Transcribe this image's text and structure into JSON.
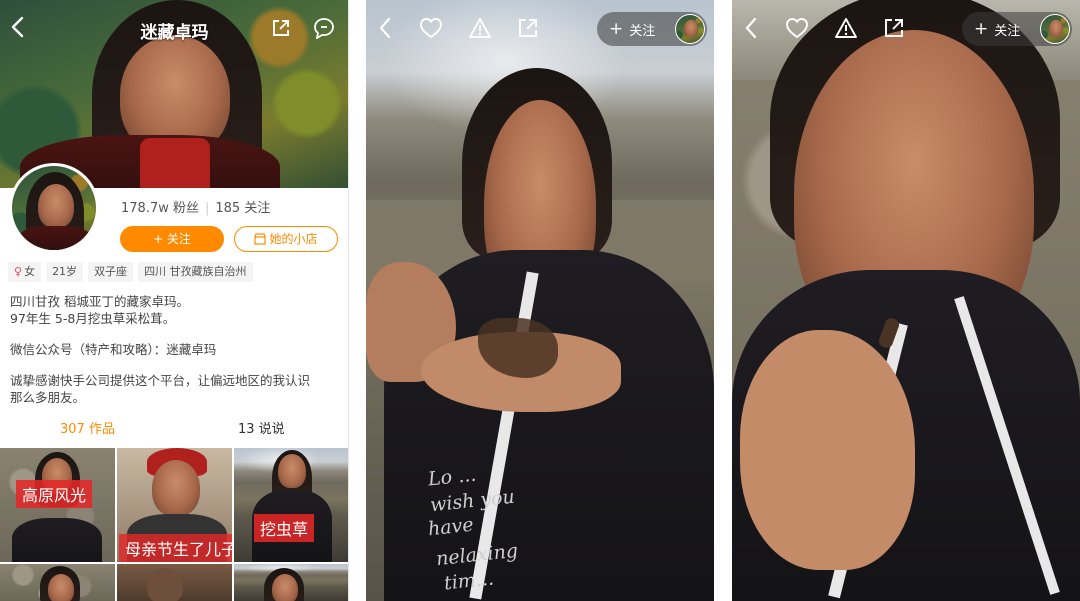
{
  "profile": {
    "title": "迷藏卓玛",
    "fans": "178.7w 粉丝",
    "following": "185 关注",
    "follow_button": "+ 关注",
    "shop_button": "她的小店",
    "tags": [
      {
        "symbol": "♀",
        "label": "女"
      },
      {
        "symbol": "",
        "label": "21岁"
      },
      {
        "symbol": "",
        "label": "双子座"
      },
      {
        "symbol": "",
        "label": "四川 甘孜藏族自治州"
      }
    ],
    "bio_lines": [
      "四川甘孜 稻城亚丁的藏家卓玛。",
      "97年生 5-8月挖虫草采松茸。"
    ],
    "wechat_line": "微信公众号（特产和攻略）：迷藏卓玛",
    "thanks_lines": [
      "诚挚感谢快手公司提供这个平台，让偏远地区的我认识",
      "那么多朋友。"
    ],
    "tab_works": "307 作品",
    "tab_talks": "13 说说",
    "grid_labels": [
      "高原风光",
      "母亲节生了儿子",
      "挖虫草"
    ],
    "accent_color": "#ff8a00"
  },
  "video1": {
    "follow_label": "关注",
    "icons": [
      "back-icon",
      "heart-icon",
      "warning-icon",
      "share-icon"
    ],
    "robe_text": [
      "Lo ...",
      "wish you",
      "have",
      "nelaxing",
      "tim..."
    ]
  },
  "video2": {
    "follow_label": "关注",
    "icons": [
      "back-icon",
      "heart-icon",
      "warning-icon",
      "share-icon"
    ]
  }
}
